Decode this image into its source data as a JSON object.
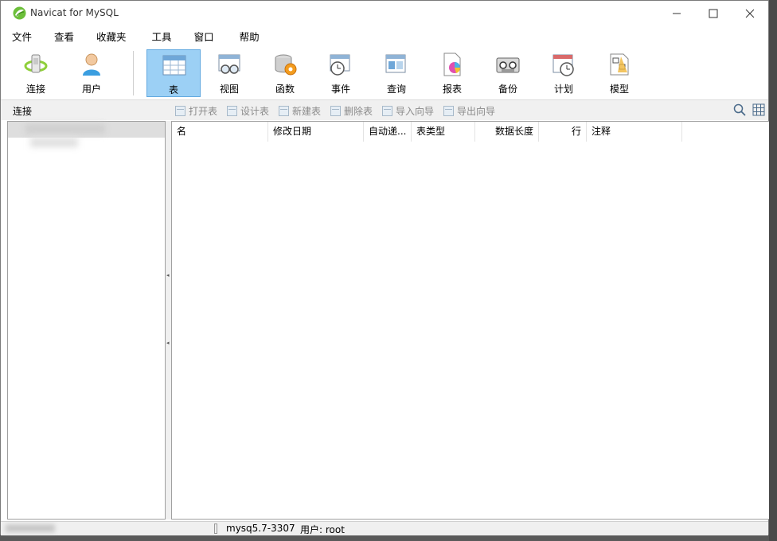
{
  "window": {
    "title": "Navicat for MySQL"
  },
  "menu": [
    "文件",
    "查看",
    "收藏夹",
    "工具",
    "窗口",
    "帮助"
  ],
  "toolbar": {
    "connect": "连接",
    "user": "用户",
    "table": "表",
    "view": "视图",
    "function": "函数",
    "event": "事件",
    "query": "查询",
    "report": "报表",
    "backup": "备份",
    "schedule": "计划",
    "model": "模型"
  },
  "subbar": {
    "connection_label": "连接",
    "open_table": "打开表",
    "design_table": "设计表",
    "new_table": "新建表",
    "delete_table": "删除表",
    "import_wizard": "导入向导",
    "export_wizard": "导出向导"
  },
  "table_columns": [
    "名",
    "修改日期",
    "自动递...",
    "表类型",
    "数据长度",
    "行",
    "注释"
  ],
  "status": {
    "connection": "mysq5.7-3307",
    "user": "用户: root"
  },
  "colors": {
    "active_tool_bg": "#9cd0f5",
    "active_tool_border": "#62a9e0"
  }
}
